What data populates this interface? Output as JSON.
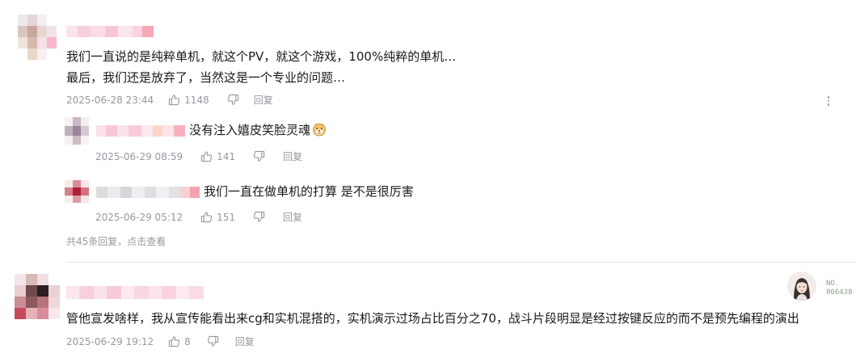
{
  "comments": [
    {
      "text_lines": [
        "我们一直说的是纯粹单机，就这个PV，就这个游戏，100%纯粹的单机…",
        "最后，我们还是放弃了，当然这是一个专业的问题…"
      ],
      "time": "2025-06-28 23:44",
      "likes": "1148",
      "reply_label": "回复",
      "more_icon": "more-vertical-icon",
      "replies": [
        {
          "text": "没有注入嬉皮笑脸灵魂",
          "emoji": "doge-emoji-icon",
          "time": "2025-06-29 08:59",
          "likes": "141",
          "reply_label": "回复"
        },
        {
          "text": "我们一直在做单机的打算 是不是很厉害",
          "time": "2025-06-29 05:12",
          "likes": "151",
          "reply_label": "回复"
        }
      ],
      "view_more": "共45条回复，点击查看"
    },
    {
      "text": "管他宣发啥样，我从宣传能看出来cg和实机混搭的，实机演示过场占比百分之70，战斗片段明显是经过按键反应的而不是预先编程的演出",
      "time": "2025-06-29 19:12",
      "likes": "8",
      "reply_label": "回复",
      "badge": {
        "no_label": "NO.",
        "number": "006438"
      }
    }
  ],
  "colors": {
    "text": "#18191c",
    "meta": "#9499a0",
    "divider": "#e3e5e7",
    "badge_text": "#8fa18f"
  }
}
